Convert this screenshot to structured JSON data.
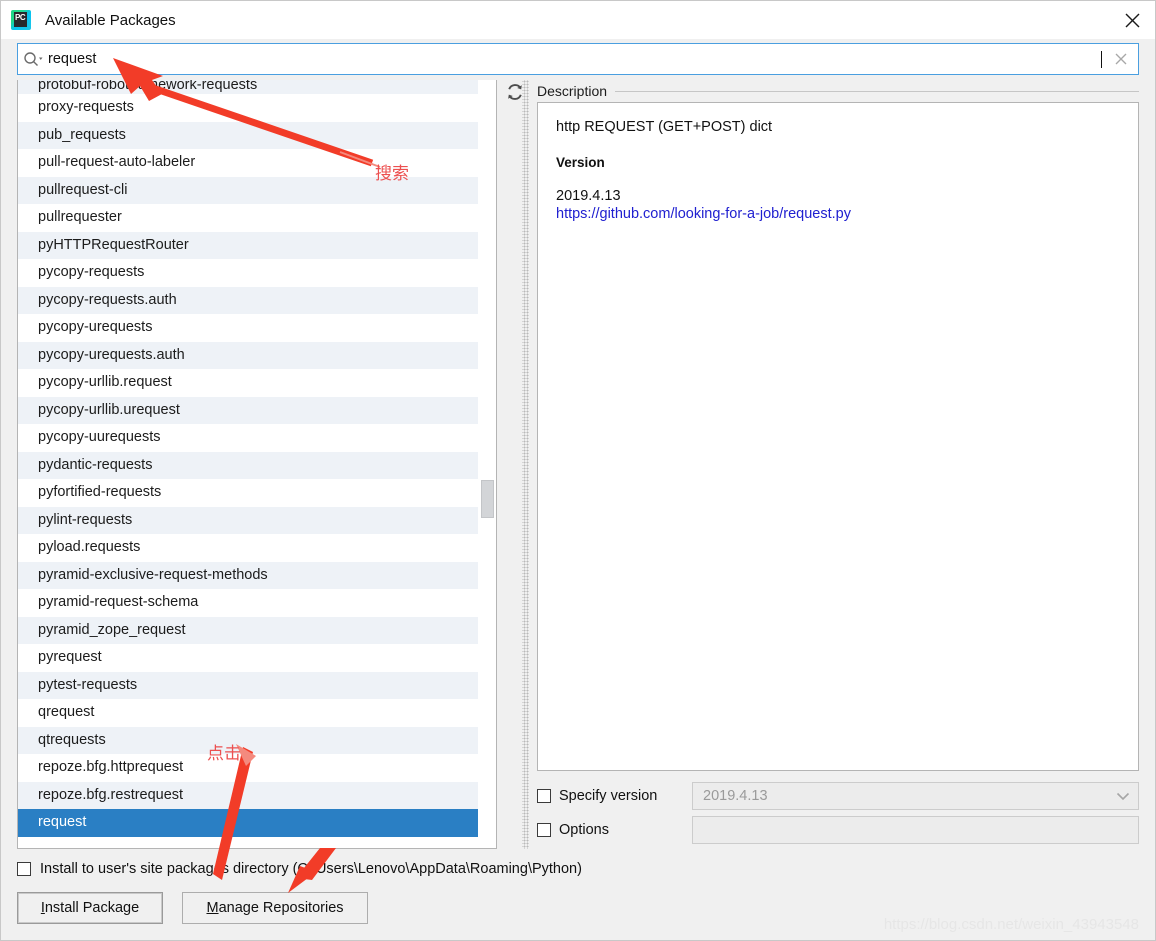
{
  "window": {
    "title": "Available Packages",
    "app_icon": "pycharm-icon",
    "close_icon": "close-icon"
  },
  "search": {
    "icon": "search-icon",
    "value": "request",
    "clear_icon": "clear-icon"
  },
  "toolbar": {
    "refresh_icon": "refresh-icon"
  },
  "package_list": {
    "items": [
      {
        "name": "protobuf-robotframework-requests",
        "clipped": true,
        "selected": false
      },
      {
        "name": "proxy-requests",
        "clipped": false,
        "selected": false
      },
      {
        "name": "pub_requests",
        "clipped": false,
        "selected": false
      },
      {
        "name": "pull-request-auto-labeler",
        "clipped": false,
        "selected": false
      },
      {
        "name": "pullrequest-cli",
        "clipped": false,
        "selected": false
      },
      {
        "name": "pullrequester",
        "clipped": false,
        "selected": false
      },
      {
        "name": "pyHTTPRequestRouter",
        "clipped": false,
        "selected": false
      },
      {
        "name": "pycopy-requests",
        "clipped": false,
        "selected": false
      },
      {
        "name": "pycopy-requests.auth",
        "clipped": false,
        "selected": false
      },
      {
        "name": "pycopy-urequests",
        "clipped": false,
        "selected": false
      },
      {
        "name": "pycopy-urequests.auth",
        "clipped": false,
        "selected": false
      },
      {
        "name": "pycopy-urllib.request",
        "clipped": false,
        "selected": false
      },
      {
        "name": "pycopy-urllib.urequest",
        "clipped": false,
        "selected": false
      },
      {
        "name": "pycopy-uurequests",
        "clipped": false,
        "selected": false
      },
      {
        "name": "pydantic-requests",
        "clipped": false,
        "selected": false
      },
      {
        "name": "pyfortified-requests",
        "clipped": false,
        "selected": false
      },
      {
        "name": "pylint-requests",
        "clipped": false,
        "selected": false
      },
      {
        "name": "pyload.requests",
        "clipped": false,
        "selected": false
      },
      {
        "name": "pyramid-exclusive-request-methods",
        "clipped": false,
        "selected": false
      },
      {
        "name": "pyramid-request-schema",
        "clipped": false,
        "selected": false
      },
      {
        "name": "pyramid_zope_request",
        "clipped": false,
        "selected": false
      },
      {
        "name": "pyrequest",
        "clipped": false,
        "selected": false
      },
      {
        "name": "pytest-requests",
        "clipped": false,
        "selected": false
      },
      {
        "name": "qrequest",
        "clipped": false,
        "selected": false
      },
      {
        "name": "qtrequests",
        "clipped": false,
        "selected": false
      },
      {
        "name": "repoze.bfg.httprequest",
        "clipped": false,
        "selected": false
      },
      {
        "name": "repoze.bfg.restrequest",
        "clipped": false,
        "selected": false
      },
      {
        "name": "request",
        "clipped": false,
        "selected": true
      }
    ]
  },
  "description": {
    "legend": "Description",
    "summary": "http REQUEST (GET+POST) dict",
    "version_label": "Version",
    "version_value": "2019.4.13",
    "link": "https://github.com/looking-for-a-job/request.py"
  },
  "options": {
    "specify_version_label": "Specify version",
    "specify_version_checked": false,
    "specify_version_value": "2019.4.13",
    "specify_version_arrow": "chevron-down-icon",
    "options_label": "Options",
    "options_checked": false,
    "options_value": ""
  },
  "bottom": {
    "user_site_label": "Install to user's site packages directory (C:\\Users\\Lenovo\\AppData\\Roaming\\Python)",
    "user_site_checked": false,
    "install_button": {
      "prefix": "",
      "mnemonic": "I",
      "suffix": "nstall Package"
    },
    "manage_button": {
      "prefix": "",
      "mnemonic": "M",
      "suffix": "anage Repositories"
    }
  },
  "annotations": [
    {
      "text": "搜索",
      "name": "annotation-search"
    },
    {
      "text": "点击",
      "name": "annotation-click"
    }
  ],
  "watermark": "https://blog.csdn.net/weixin_43943548",
  "colors": {
    "selection": "#2a7fc4",
    "row_alt": "#eef2f7",
    "link": "#2020d0",
    "annotation": "#ec5050",
    "focus_border": "#4a9fe0"
  }
}
